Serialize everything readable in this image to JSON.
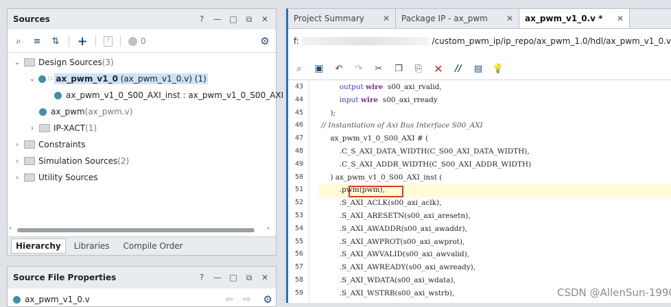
{
  "sources_panel": {
    "title": "Sources",
    "title_controls": [
      "?",
      "—",
      "□",
      "⧉",
      "✕"
    ],
    "toolbar": {
      "search": "⌕",
      "collapse": "≡",
      "expand": "⇅",
      "add": "+",
      "doc": "?",
      "count": "0",
      "gear": "⚙"
    },
    "tree": [
      {
        "label": "Design Sources",
        "suffix": " (3)"
      },
      {
        "label": "ax_pwm_v1_0",
        "suffix": " (ax_pwm_v1_0.v) (1)"
      },
      {
        "label": "ax_pwm_v1_0_S00_AXI_inst : ax_pwm_v1_0_S00_AXI (",
        "suffix": ""
      },
      {
        "label": "ax_pwm",
        "suffix": " (ax_pwm.v)"
      },
      {
        "label": "IP-XACT",
        "suffix": " (1)"
      },
      {
        "label": "Constraints",
        "suffix": ""
      },
      {
        "label": "Simulation Sources",
        "suffix": " (2)"
      },
      {
        "label": "Utility Sources",
        "suffix": ""
      }
    ],
    "bottom_tabs": [
      "Hierarchy",
      "Libraries",
      "Compile Order"
    ]
  },
  "properties_panel": {
    "title": "Source File Properties",
    "file": "ax_pwm_v1_0.v",
    "controls": [
      "?",
      "—",
      "□",
      "⧉",
      "✕"
    ]
  },
  "editor": {
    "tabs": [
      {
        "label": "Project Summary",
        "close": "✕"
      },
      {
        "label": "Package IP - ax_pwm",
        "close": "✕"
      },
      {
        "label": "ax_pwm_v1_0.v *",
        "close": "✕"
      }
    ],
    "path_prefix": "f:",
    "path": "/custom_pwm_ip/ip_repo/ax_pwm_1.0/hdl/ax_pwm_v1_0.v",
    "lines": [
      {
        "n": "43",
        "text": "        output wire  s00_axi_rvalid,"
      },
      {
        "n": "44",
        "text": "        input wire  s00_axi_rready"
      },
      {
        "n": "45",
        "text": "    );"
      },
      {
        "n": "46",
        "text": "// Instantiation of Axi Bus Interface S00_AXI"
      },
      {
        "n": "47",
        "text": "    ax_pwm_v1_0_S00_AXI # ("
      },
      {
        "n": "48",
        "text": "        .C_S_AXI_DATA_WIDTH(C_S00_AXI_DATA_WIDTH),"
      },
      {
        "n": "49",
        "text": "        .C_S_AXI_ADDR_WIDTH(C_S00_AXI_ADDR_WIDTH)"
      },
      {
        "n": "50",
        "text": "    ) ax_pwm_v1_0_S00_AXI_inst ("
      },
      {
        "n": "51",
        "text": "        .pwm(pwm),"
      },
      {
        "n": "52",
        "text": "        .S_AXI_ACLK(s00_axi_aclk),"
      },
      {
        "n": "53",
        "text": "        .S_AXI_ARESETN(s00_axi_aresetn),"
      },
      {
        "n": "54",
        "text": "        .S_AXI_AWADDR(s00_axi_awaddr),"
      },
      {
        "n": "55",
        "text": "        .S_AXI_AWPROT(s00_axi_awprot),"
      },
      {
        "n": "56",
        "text": "        .S_AXI_AWVALID(s00_axi_awvalid),"
      },
      {
        "n": "57",
        "text": "        .S_AXI_AWREADY(s00_axi_awready),"
      },
      {
        "n": "58",
        "text": "        .S_AXI_WDATA(s00_axi_wdata),"
      },
      {
        "n": "59",
        "text": "        .S_AXI_WSTRB(s00_axi_wstrb),"
      }
    ],
    "watermark": "CSDN @AllenSun-1990"
  },
  "colors": {
    "accent": "#2a6fb0",
    "highlight_line": "#fffbd6",
    "selection": "#cde3f7",
    "annotation_box": "#e03b24"
  }
}
